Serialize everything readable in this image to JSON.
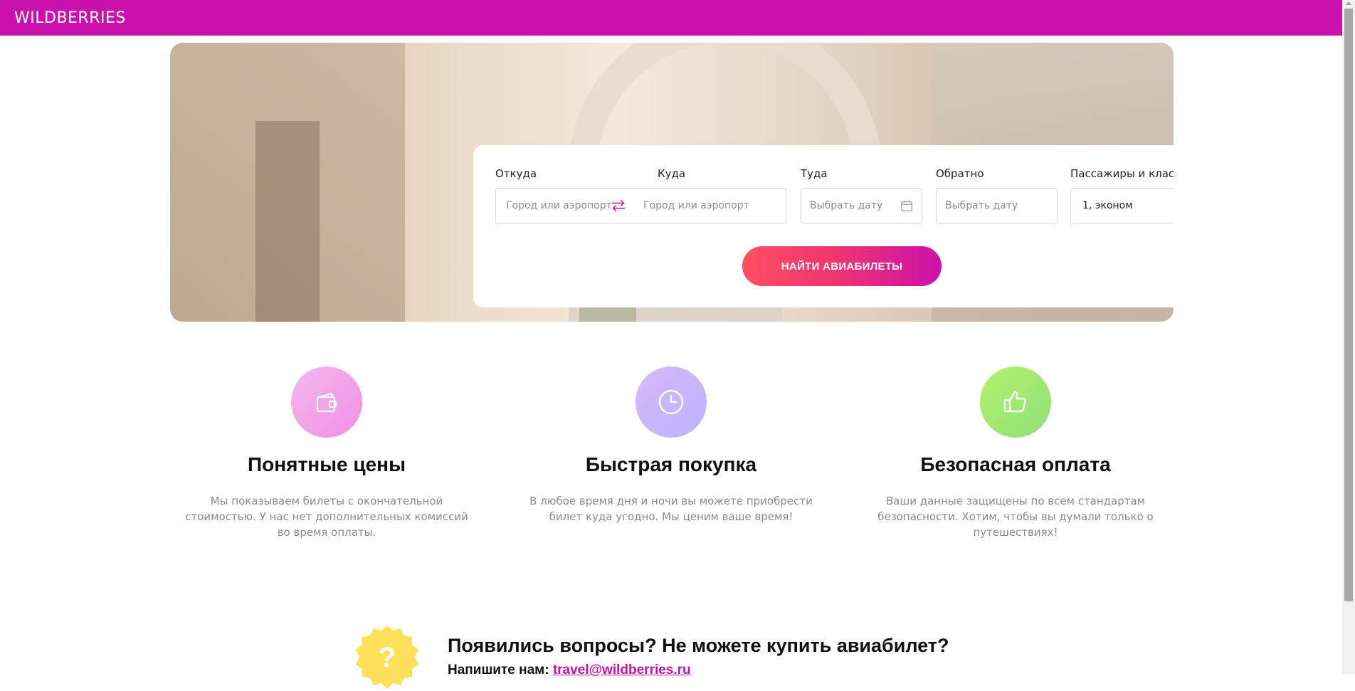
{
  "header": {
    "logo": "WILDBERRIES",
    "brand_color": "#cb11ab"
  },
  "search": {
    "from": {
      "label": "Откуда",
      "placeholder": "Город или аэропорт",
      "value": ""
    },
    "to": {
      "label": "Куда",
      "placeholder": "Город или аэропорт",
      "value": ""
    },
    "depart": {
      "label": "Туда",
      "placeholder": "Выбрать дату",
      "value": ""
    },
    "return": {
      "label": "Обратно",
      "placeholder": "Выбрать дату",
      "value": ""
    },
    "passengers": {
      "label": "Пассажиры и класс",
      "value": "1, эконом"
    },
    "button": "НАЙТИ АВИАБИЛЕТЫ"
  },
  "features": [
    {
      "icon": "wallet-icon",
      "title": "Понятные цены",
      "text": "Мы показываем билеты с окончательной стоимостью. У нас нет дополнительных комиссий во время оплаты."
    },
    {
      "icon": "clock-icon",
      "title": "Быстрая покупка",
      "text": "В любое время дня и ночи вы можете приобрести билет куда угодно. Мы ценим ваше время!"
    },
    {
      "icon": "thumbs-up-icon",
      "title": "Безопасная оплата",
      "text": "Ваши данные защищены по всем стандартам безопасности. Хотим, чтобы вы думали только о путешествиях!"
    }
  ],
  "help": {
    "badge": "?",
    "title": "Появились вопросы? Не можете купить авиабилет?",
    "write_label": "Напишите нам:",
    "email": "travel@wildberries.ru"
  }
}
